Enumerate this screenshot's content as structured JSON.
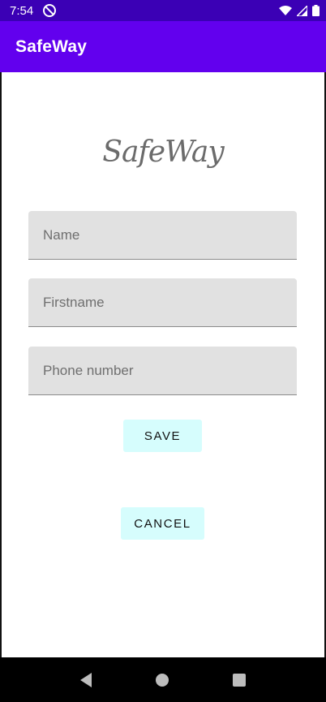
{
  "status_bar": {
    "time": "7:54"
  },
  "app_bar": {
    "title": "SafeWay"
  },
  "logo": {
    "text": "SafeWay"
  },
  "form": {
    "name_placeholder": "Name",
    "firstname_placeholder": "Firstname",
    "phone_placeholder": "Phone number"
  },
  "buttons": {
    "save_label": "SAVE",
    "cancel_label": "CANCEL"
  },
  "colors": {
    "status_bar": "#3b00b5",
    "app_bar": "#6200ee",
    "field_bg": "#e1e1e1",
    "button_bg": "#d6fdfd"
  }
}
